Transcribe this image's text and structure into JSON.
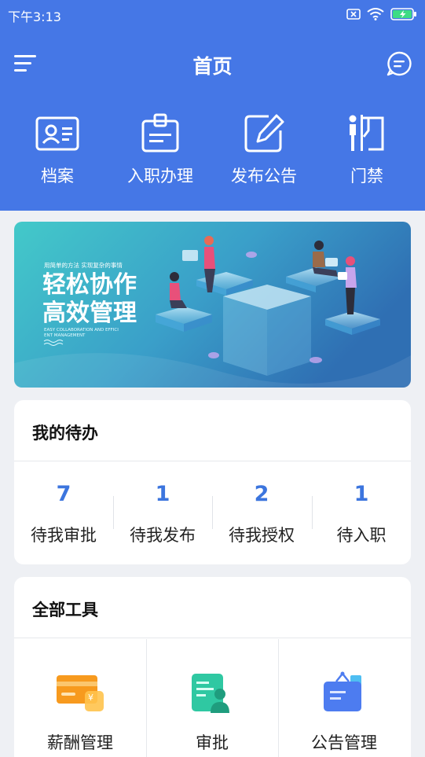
{
  "status_bar": {
    "time": "下午3:13",
    "icons": [
      "sim-x-icon",
      "wifi-icon",
      "battery-charging-icon"
    ]
  },
  "header": {
    "title": "首页",
    "menu_icon": "hamburger-menu-icon",
    "message_icon": "chat-bubble-icon",
    "background_color": "#4577e6"
  },
  "quick_actions": [
    {
      "label": "档案",
      "icon": "id-card-icon"
    },
    {
      "label": "入职办理",
      "icon": "badge-icon"
    },
    {
      "label": "发布公告",
      "icon": "edit-icon"
    },
    {
      "label": "门禁",
      "icon": "door-access-icon"
    }
  ],
  "banner": {
    "tagline": "用简单的方法  实现复杂的事情",
    "headline_1": "轻松协作",
    "headline_2": "高效管理",
    "english_1": "EASY COLLABORATION AND EFFICI",
    "english_2": "ENT MANAGEMENT"
  },
  "todo": {
    "title": "我的待办",
    "items": [
      {
        "count": "7",
        "label": "待我审批"
      },
      {
        "count": "1",
        "label": "待我发布"
      },
      {
        "count": "2",
        "label": "待我授权"
      },
      {
        "count": "1",
        "label": "待入职"
      }
    ],
    "accent_color": "#3c75de"
  },
  "tools": {
    "title": "全部工具",
    "items": [
      {
        "label": "薪酬管理",
        "icon": "salary-card-icon",
        "color": "#f79a1e"
      },
      {
        "label": "审批",
        "icon": "approval-icon",
        "color": "#2fc8a2"
      },
      {
        "label": "公告管理",
        "icon": "announcement-board-icon",
        "color": "#4d7cf0"
      }
    ]
  }
}
